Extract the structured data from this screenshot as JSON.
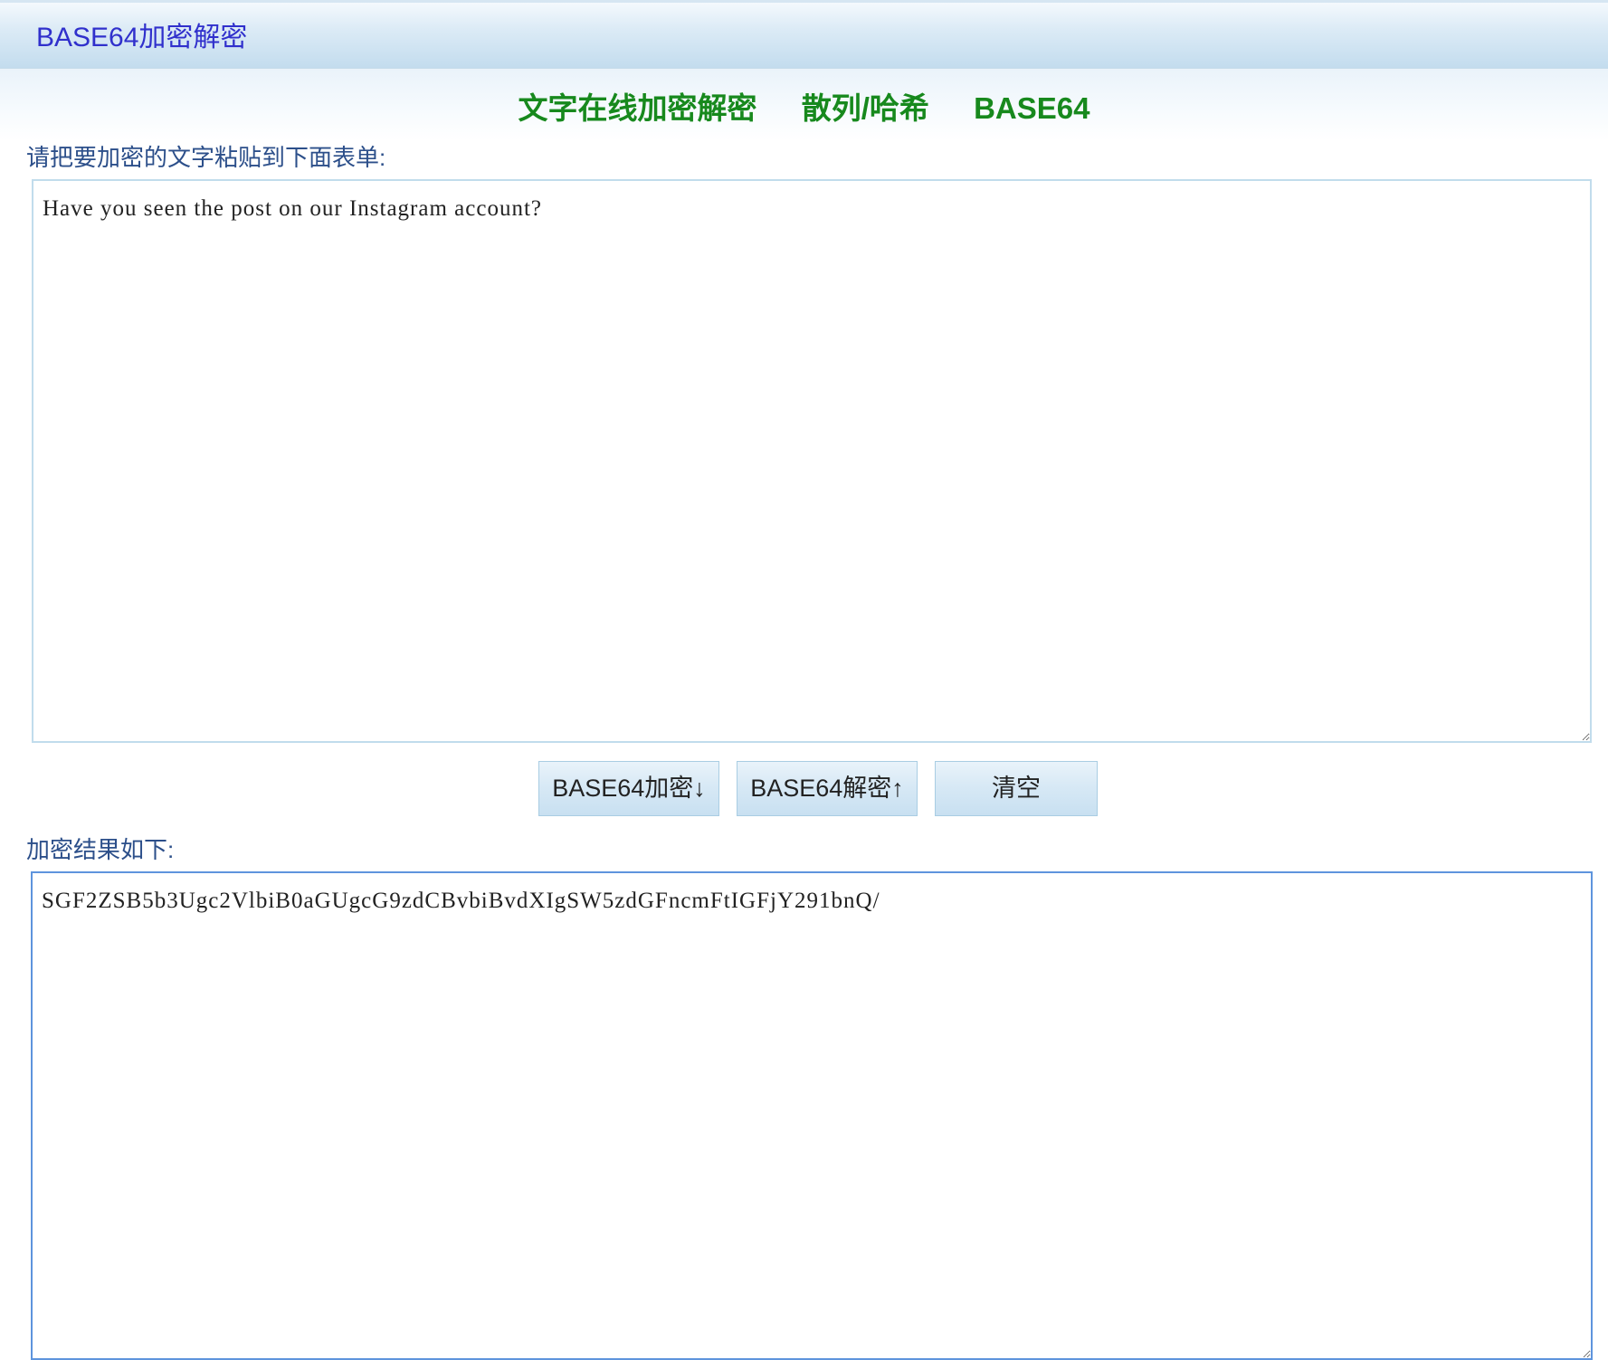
{
  "header": {
    "title": "BASE64加密解密"
  },
  "nav": {
    "items": [
      {
        "label": "文字在线加密解密"
      },
      {
        "label": "散列/哈希"
      },
      {
        "label": "BASE64"
      }
    ]
  },
  "input": {
    "label": "请把要加密的文字粘贴到下面表单:",
    "value": "Have you seen the post on our Instagram account?"
  },
  "buttons": {
    "encode": "BASE64加密↓",
    "decode": "BASE64解密↑",
    "clear": "清空"
  },
  "output": {
    "label": "加密结果如下:",
    "value": "SGF2ZSB5b3Ugc2VlbiB0aGUgcG9zdCBvbiBvdXIgSW5zdGFncmFtIGFjY291bnQ/"
  }
}
